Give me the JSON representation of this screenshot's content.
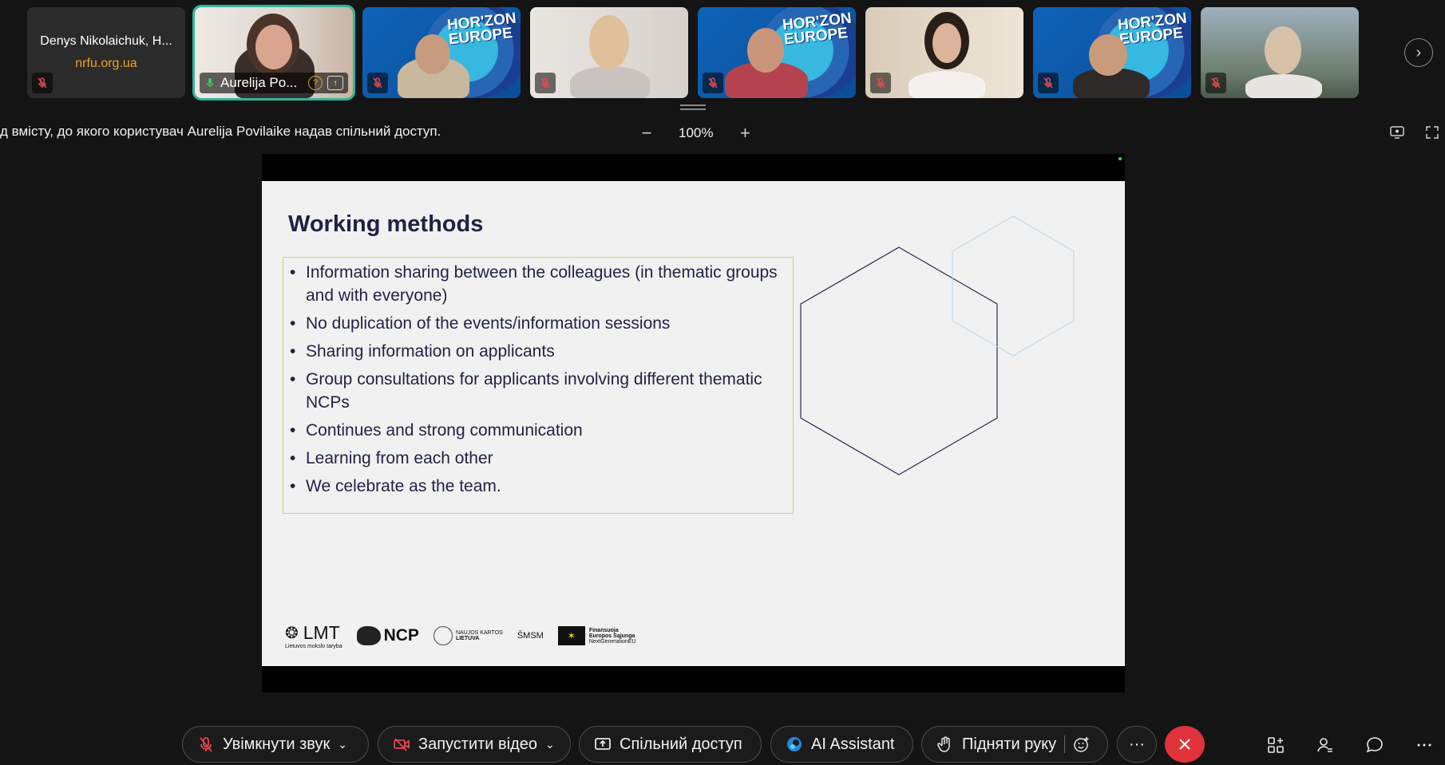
{
  "participants": [
    {
      "name": "Denys Nikolaichuk, H...",
      "org": "nrfu.org.ua",
      "muted": true,
      "video": false
    },
    {
      "name": "Aurelija Po...",
      "active_speaker": true,
      "video": true
    },
    {
      "name": "",
      "muted": true,
      "video": true,
      "poster": "HOR'ZON EUROPE"
    },
    {
      "name": "",
      "muted": true,
      "video": true
    },
    {
      "name": "",
      "muted": true,
      "video": true,
      "poster": "HOR'ZON EUROPE"
    },
    {
      "name": "",
      "muted": true,
      "video": true
    },
    {
      "name": "",
      "muted": true,
      "video": true,
      "poster": "HOR'ZON EUROPE"
    },
    {
      "name": "",
      "muted": true,
      "video": true
    }
  ],
  "poster_text": {
    "line1": "HOR'ZON",
    "line2": "EUROPE"
  },
  "share_info": "д вмісту, до якого користувач Aurelija Povilaike надав спільний доступ.",
  "zoom": {
    "minus": "−",
    "level": "100%",
    "plus": "+"
  },
  "slide": {
    "title": "Working methods",
    "bullets": [
      "Information sharing between the colleagues (in thematic groups and with everyone)",
      "No duplication of the events/information sessions",
      "Sharing information on applicants",
      "Group consultations for applicants involving different thematic NCPs",
      "Continues and strong communication",
      "Learning from each other",
      "We celebrate as the team."
    ],
    "logos": {
      "lmt": "LMT",
      "lmt_sub": "Lietuvos mokslo taryba",
      "ncp": "NCP",
      "naujos": "NAUJOS KARTOS",
      "lietuva": "LIETUVA",
      "smsm": "ŠMSM",
      "eu_line1": "Finansuoja",
      "eu_line2": "Europos Sąjunga",
      "eu_line3": "NextGenerationEU"
    }
  },
  "controls": {
    "unmute": "Увімкнути звук",
    "start_video": "Запустити відео",
    "share": "Спільний доступ",
    "ai": "AI Assistant",
    "raise_hand": "Підняти руку",
    "more": "···"
  },
  "colors": {
    "accent_active": "#2fb59a",
    "end_call": "#e0323b",
    "slide_title": "#1f2244",
    "org_text": "#f0a020"
  }
}
